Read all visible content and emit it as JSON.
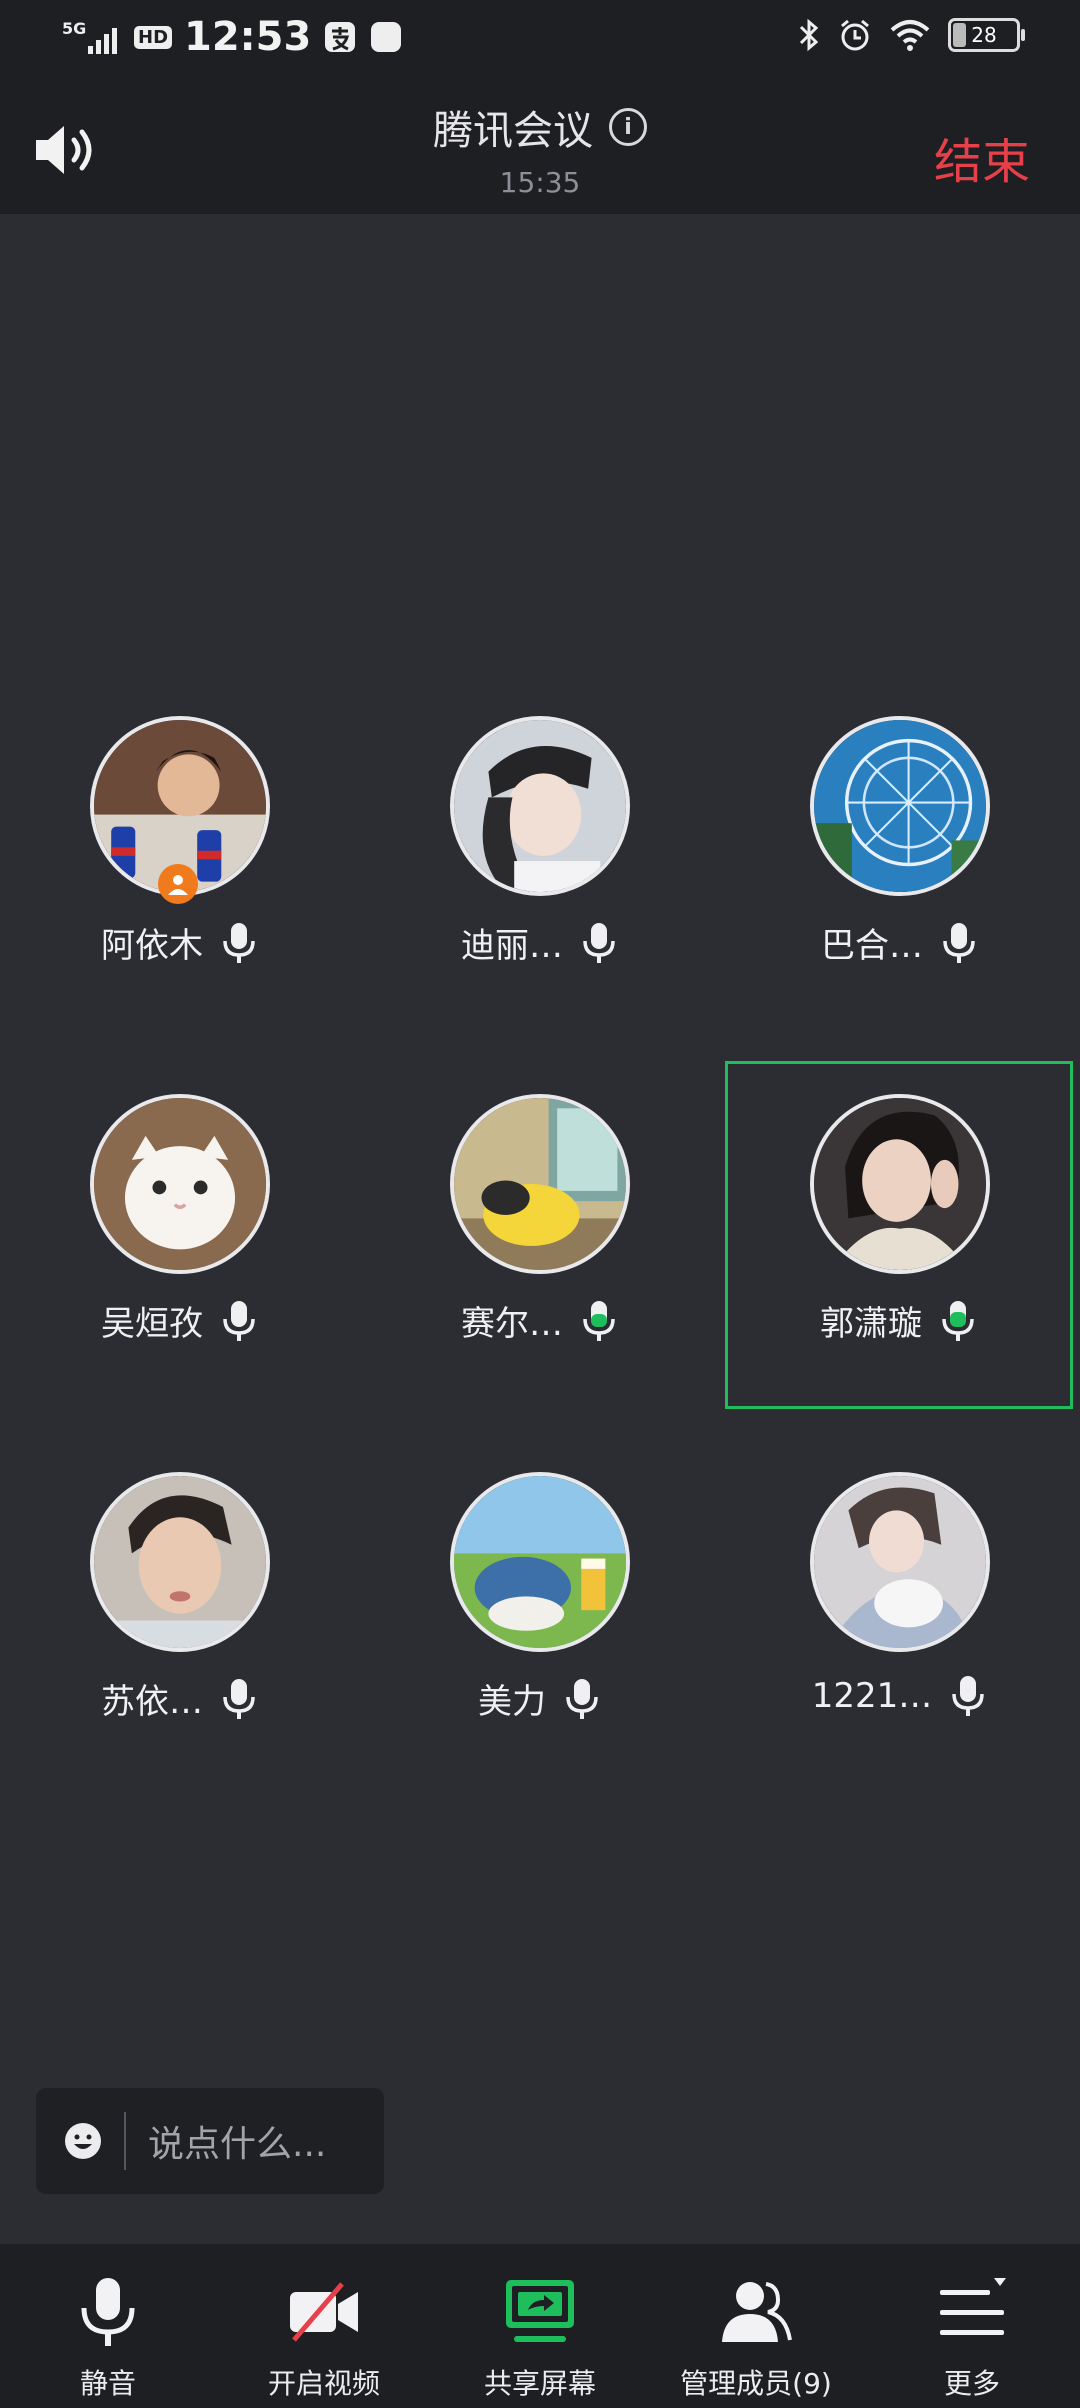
{
  "status_bar": {
    "network": "5G",
    "hd": "HD",
    "time": "12:53",
    "battery": "28"
  },
  "header": {
    "title": "腾讯会议",
    "timer": "15:35",
    "end_label": "结束"
  },
  "participants": [
    {
      "name": "阿依木",
      "host": true,
      "speaking": false
    },
    {
      "name": "迪丽…",
      "host": false,
      "speaking": false
    },
    {
      "name": "巴合…",
      "host": false,
      "speaking": false
    },
    {
      "name": "吴烜孜",
      "host": false,
      "speaking": false
    },
    {
      "name": "赛尔…",
      "host": false,
      "speaking": true
    },
    {
      "name": "郭潇璇",
      "host": false,
      "speaking": true,
      "active": true
    },
    {
      "name": "苏依…",
      "host": false,
      "speaking": false
    },
    {
      "name": "美力",
      "host": false,
      "speaking": false
    },
    {
      "name": "1221…",
      "host": false,
      "speaking": false
    }
  ],
  "chat": {
    "placeholder": "说点什么..."
  },
  "toolbar": {
    "mute": "静音",
    "video": "开启视频",
    "share": "共享屏幕",
    "members": "管理成员(9)",
    "more": "更多"
  },
  "colors": {
    "background": "#2b2d33",
    "bar": "#1e1f23",
    "end_red": "#e8404a",
    "active_green": "#1fbe5c",
    "host_orange": "#f07a1c"
  },
  "icons": [
    "speaker-icon",
    "info-icon",
    "mic-icon",
    "host-icon",
    "emoji-icon",
    "video-off-icon",
    "share-screen-icon",
    "members-icon",
    "menu-icon"
  ]
}
